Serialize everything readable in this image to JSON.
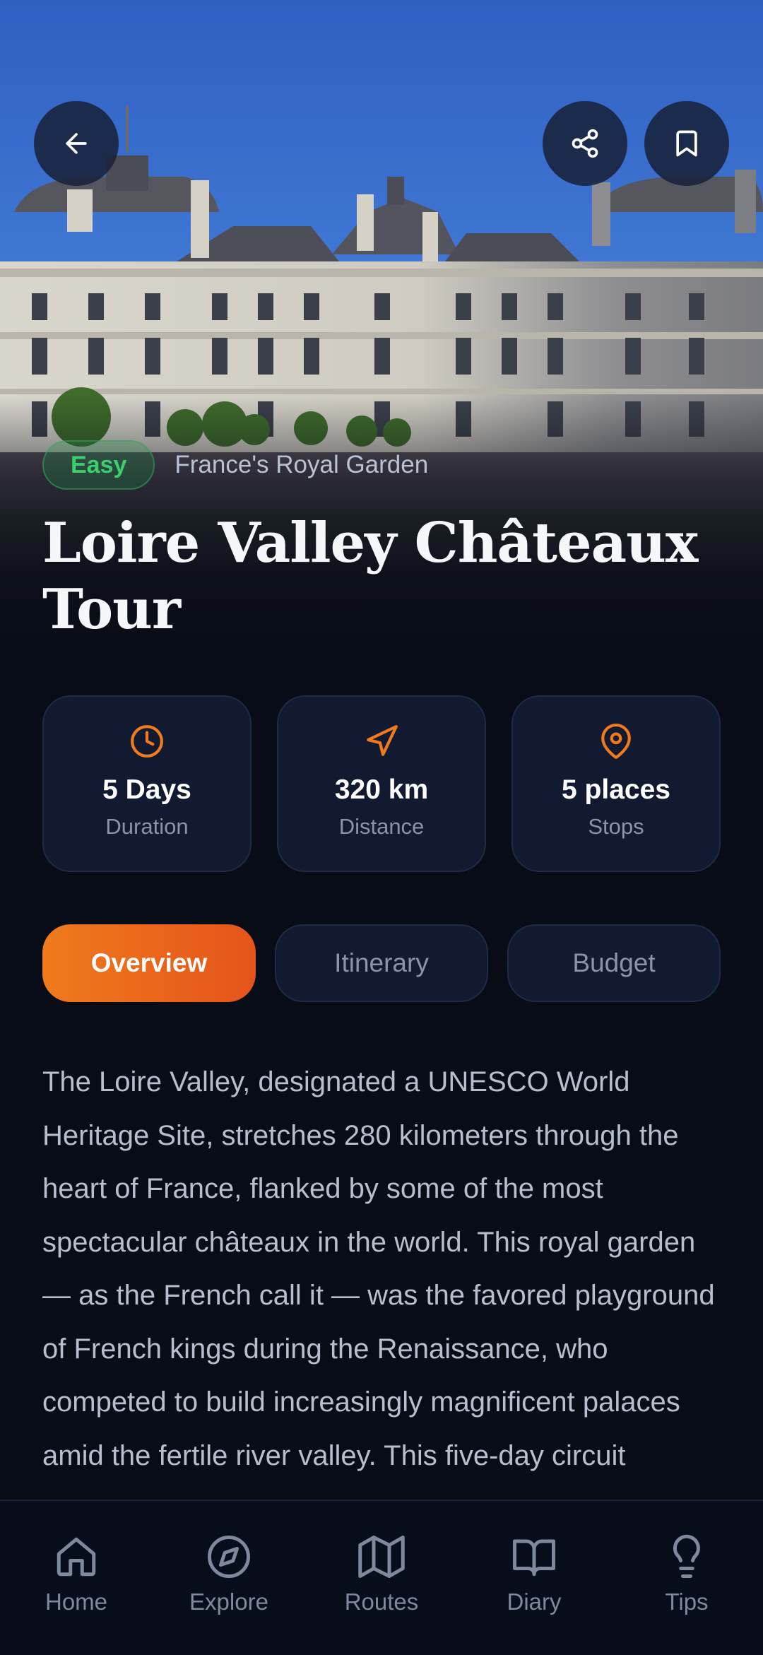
{
  "hero": {
    "difficulty_badge": "Easy",
    "subtitle": "France's Royal Garden",
    "title": "Loire Valley Châteaux Tour"
  },
  "header_icons": [
    "back-arrow-icon",
    "share-icon",
    "bookmark-icon"
  ],
  "stats": [
    {
      "icon": "clock-icon",
      "value": "5 Days",
      "label": "Duration"
    },
    {
      "icon": "navigation-icon",
      "value": "320 km",
      "label": "Distance"
    },
    {
      "icon": "map-pin-icon",
      "value": "5 places",
      "label": "Stops"
    }
  ],
  "tabs": [
    {
      "label": "Overview",
      "active": true
    },
    {
      "label": "Itinerary",
      "active": false
    },
    {
      "label": "Budget",
      "active": false
    }
  ],
  "description": "The Loire Valley, designated a UNESCO World Heritage Site, stretches 280 kilometers through the heart of France, flanked by some of the most spectacular châteaux in the world. This royal garden — as the French call it — was the favored playground of French kings during the Renaissance, who competed to build increasingly magnificent palaces amid the fertile river valley. This five-day circuit",
  "nav": [
    {
      "icon": "home-icon",
      "label": "Home"
    },
    {
      "icon": "compass-icon",
      "label": "Explore"
    },
    {
      "icon": "map-icon",
      "label": "Routes"
    },
    {
      "icon": "book-icon",
      "label": "Diary"
    },
    {
      "icon": "lightbulb-icon",
      "label": "Tips"
    }
  ],
  "colors": {
    "accent": "#f07a1c",
    "background": "#080c17",
    "card": "#111a30",
    "badge_green": "#3ccf6e"
  }
}
